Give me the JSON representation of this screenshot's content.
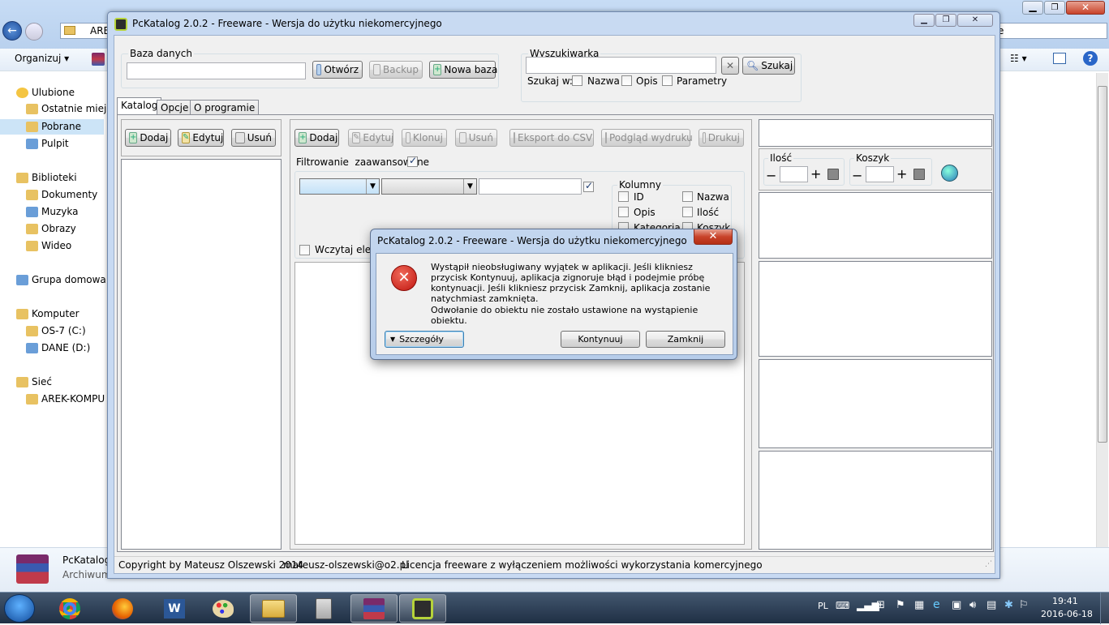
{
  "explorer": {
    "address_fragment": "ARE",
    "search_fragment": "e",
    "organize_label": "Organizuj",
    "nav": [
      {
        "label": "Ulubione",
        "icon": "star-icon"
      },
      {
        "label": "Ostatnie miejs",
        "icon": "recent-places-icon"
      },
      {
        "label": "Pobrane",
        "icon": "downloads-folder-icon"
      },
      {
        "label": "Pulpit",
        "icon": "desktop-icon"
      },
      {
        "label": "Biblioteki",
        "icon": "libraries-icon"
      },
      {
        "label": "Dokumenty",
        "icon": "documents-icon"
      },
      {
        "label": "Muzyka",
        "icon": "music-icon"
      },
      {
        "label": "Obrazy",
        "icon": "pictures-icon"
      },
      {
        "label": "Wideo",
        "icon": "video-icon"
      },
      {
        "label": "Grupa domowa",
        "icon": "homegroup-icon"
      },
      {
        "label": "Komputer",
        "icon": "computer-icon"
      },
      {
        "label": "OS-7 (C:)",
        "icon": "drive-c-icon"
      },
      {
        "label": "DANE (D:)",
        "icon": "drive-d-icon"
      },
      {
        "label": "Sieć",
        "icon": "network-icon"
      },
      {
        "label": "AREK-KOMPU",
        "icon": "network-computer-icon"
      }
    ],
    "details_name": "PcKatalog",
    "details_type": "Archiwum"
  },
  "app": {
    "title": "PcKatalog 2.0.2 - Freeware - Wersja do użytku niekomercyjnego",
    "db_group": "Baza danych",
    "db_path_value": "",
    "btn_open": "Otwórz",
    "btn_backup": "Backup",
    "btn_newdb": "Nowa baza",
    "search_group": "Wyszukiwarka",
    "search_value": "",
    "btn_search": "Szukaj",
    "search_in_label": "Szukaj w:",
    "search_in": [
      "Nazwa",
      "Opis",
      "Parametry"
    ],
    "tabs": [
      "Katalog",
      "Opcje",
      "O programie"
    ],
    "cat_buttons": [
      "Dodaj",
      "Edytuj",
      "Usuń"
    ],
    "item_buttons": [
      "Dodaj",
      "Edytuj",
      "Klonuj",
      "Usuń",
      "Eksport do CSV",
      "Podgląd wydruku",
      "Drukuj"
    ],
    "adv_filter_label": "Filtrowanie  zaawansowane",
    "columns_group": "Kolumny",
    "columns": [
      "ID",
      "Nazwa",
      "Opis",
      "Ilość",
      "Kategoria",
      "Koszyk"
    ],
    "load_label": "Wczytaj elem",
    "qty_label": "Ilość",
    "cart_label": "Koszyk",
    "status_copyright": "Copyright by Mateusz Olszewski 2014",
    "status_email": "mateusz-olszewski@o2.pl",
    "status_license": "Licencja freeware z wyłączeniem możliwości wykorzystania komercyjnego"
  },
  "dialog": {
    "title": "PcKatalog 2.0.2 - Freeware - Wersja do użytku niekomercyjnego",
    "message": "Wystąpił nieobsługiwany wyjątek w aplikacji. Jeśli klikniesz przycisk Kontynuuj, aplikacja zignoruje błąd i podejmie próbę kontynuacji. Jeśli klikniesz przycisk Zamknij, aplikacja zostanie natychmiast zamknięta.",
    "detail": "Odwołanie do obiektu nie zostało ustawione na wystąpienie obiektu.",
    "btn_details": "Szczegóły",
    "btn_continue": "Kontynuuj",
    "btn_close": "Zamknij"
  },
  "taskbar": {
    "lang": "PL",
    "time": "19:41",
    "date": "2016-06-18"
  }
}
